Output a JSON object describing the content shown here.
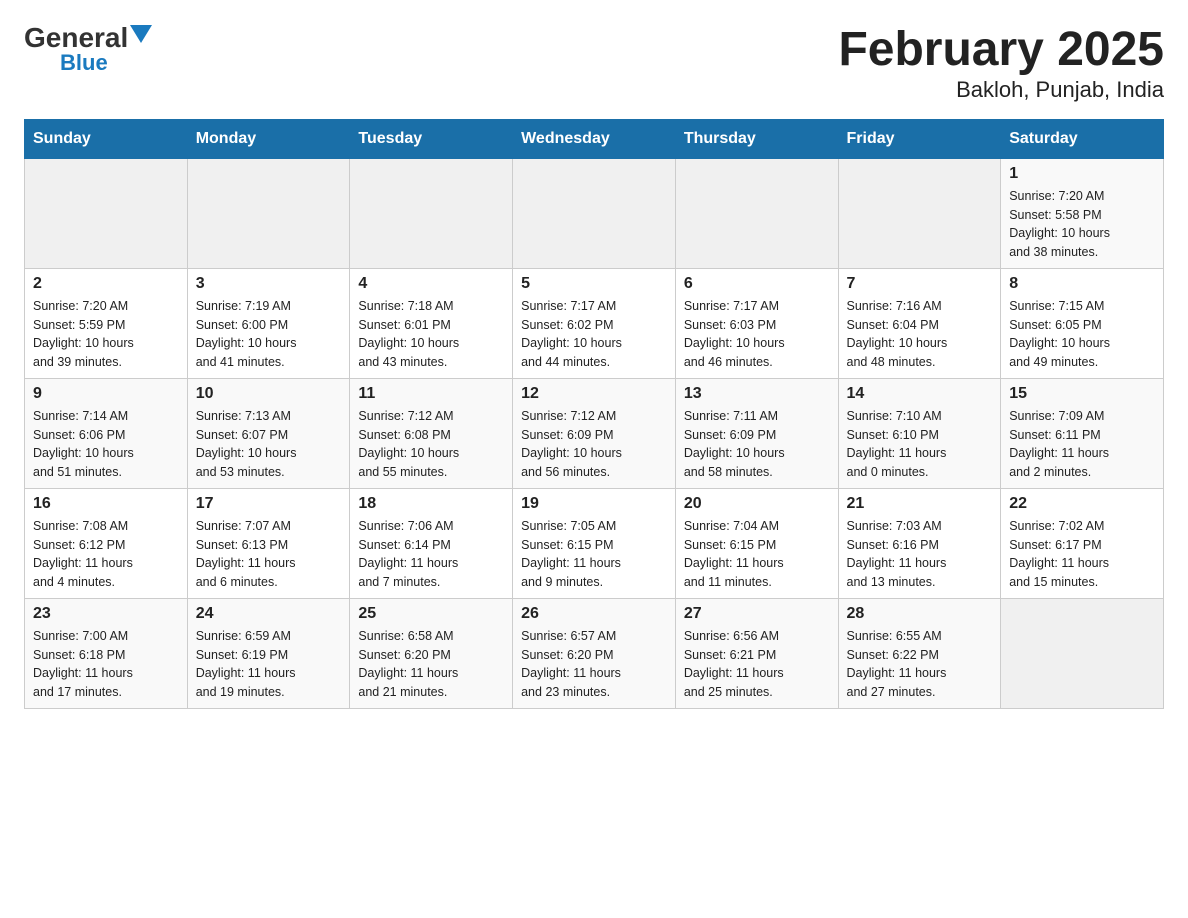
{
  "header": {
    "logo_general": "General",
    "logo_blue": "Blue",
    "title": "February 2025",
    "subtitle": "Bakloh, Punjab, India"
  },
  "calendar": {
    "days_of_week": [
      "Sunday",
      "Monday",
      "Tuesday",
      "Wednesday",
      "Thursday",
      "Friday",
      "Saturday"
    ],
    "weeks": [
      [
        {
          "day": "",
          "info": ""
        },
        {
          "day": "",
          "info": ""
        },
        {
          "day": "",
          "info": ""
        },
        {
          "day": "",
          "info": ""
        },
        {
          "day": "",
          "info": ""
        },
        {
          "day": "",
          "info": ""
        },
        {
          "day": "1",
          "info": "Sunrise: 7:20 AM\nSunset: 5:58 PM\nDaylight: 10 hours\nand 38 minutes."
        }
      ],
      [
        {
          "day": "2",
          "info": "Sunrise: 7:20 AM\nSunset: 5:59 PM\nDaylight: 10 hours\nand 39 minutes."
        },
        {
          "day": "3",
          "info": "Sunrise: 7:19 AM\nSunset: 6:00 PM\nDaylight: 10 hours\nand 41 minutes."
        },
        {
          "day": "4",
          "info": "Sunrise: 7:18 AM\nSunset: 6:01 PM\nDaylight: 10 hours\nand 43 minutes."
        },
        {
          "day": "5",
          "info": "Sunrise: 7:17 AM\nSunset: 6:02 PM\nDaylight: 10 hours\nand 44 minutes."
        },
        {
          "day": "6",
          "info": "Sunrise: 7:17 AM\nSunset: 6:03 PM\nDaylight: 10 hours\nand 46 minutes."
        },
        {
          "day": "7",
          "info": "Sunrise: 7:16 AM\nSunset: 6:04 PM\nDaylight: 10 hours\nand 48 minutes."
        },
        {
          "day": "8",
          "info": "Sunrise: 7:15 AM\nSunset: 6:05 PM\nDaylight: 10 hours\nand 49 minutes."
        }
      ],
      [
        {
          "day": "9",
          "info": "Sunrise: 7:14 AM\nSunset: 6:06 PM\nDaylight: 10 hours\nand 51 minutes."
        },
        {
          "day": "10",
          "info": "Sunrise: 7:13 AM\nSunset: 6:07 PM\nDaylight: 10 hours\nand 53 minutes."
        },
        {
          "day": "11",
          "info": "Sunrise: 7:12 AM\nSunset: 6:08 PM\nDaylight: 10 hours\nand 55 minutes."
        },
        {
          "day": "12",
          "info": "Sunrise: 7:12 AM\nSunset: 6:09 PM\nDaylight: 10 hours\nand 56 minutes."
        },
        {
          "day": "13",
          "info": "Sunrise: 7:11 AM\nSunset: 6:09 PM\nDaylight: 10 hours\nand 58 minutes."
        },
        {
          "day": "14",
          "info": "Sunrise: 7:10 AM\nSunset: 6:10 PM\nDaylight: 11 hours\nand 0 minutes."
        },
        {
          "day": "15",
          "info": "Sunrise: 7:09 AM\nSunset: 6:11 PM\nDaylight: 11 hours\nand 2 minutes."
        }
      ],
      [
        {
          "day": "16",
          "info": "Sunrise: 7:08 AM\nSunset: 6:12 PM\nDaylight: 11 hours\nand 4 minutes."
        },
        {
          "day": "17",
          "info": "Sunrise: 7:07 AM\nSunset: 6:13 PM\nDaylight: 11 hours\nand 6 minutes."
        },
        {
          "day": "18",
          "info": "Sunrise: 7:06 AM\nSunset: 6:14 PM\nDaylight: 11 hours\nand 7 minutes."
        },
        {
          "day": "19",
          "info": "Sunrise: 7:05 AM\nSunset: 6:15 PM\nDaylight: 11 hours\nand 9 minutes."
        },
        {
          "day": "20",
          "info": "Sunrise: 7:04 AM\nSunset: 6:15 PM\nDaylight: 11 hours\nand 11 minutes."
        },
        {
          "day": "21",
          "info": "Sunrise: 7:03 AM\nSunset: 6:16 PM\nDaylight: 11 hours\nand 13 minutes."
        },
        {
          "day": "22",
          "info": "Sunrise: 7:02 AM\nSunset: 6:17 PM\nDaylight: 11 hours\nand 15 minutes."
        }
      ],
      [
        {
          "day": "23",
          "info": "Sunrise: 7:00 AM\nSunset: 6:18 PM\nDaylight: 11 hours\nand 17 minutes."
        },
        {
          "day": "24",
          "info": "Sunrise: 6:59 AM\nSunset: 6:19 PM\nDaylight: 11 hours\nand 19 minutes."
        },
        {
          "day": "25",
          "info": "Sunrise: 6:58 AM\nSunset: 6:20 PM\nDaylight: 11 hours\nand 21 minutes."
        },
        {
          "day": "26",
          "info": "Sunrise: 6:57 AM\nSunset: 6:20 PM\nDaylight: 11 hours\nand 23 minutes."
        },
        {
          "day": "27",
          "info": "Sunrise: 6:56 AM\nSunset: 6:21 PM\nDaylight: 11 hours\nand 25 minutes."
        },
        {
          "day": "28",
          "info": "Sunrise: 6:55 AM\nSunset: 6:22 PM\nDaylight: 11 hours\nand 27 minutes."
        },
        {
          "day": "",
          "info": ""
        }
      ]
    ]
  }
}
